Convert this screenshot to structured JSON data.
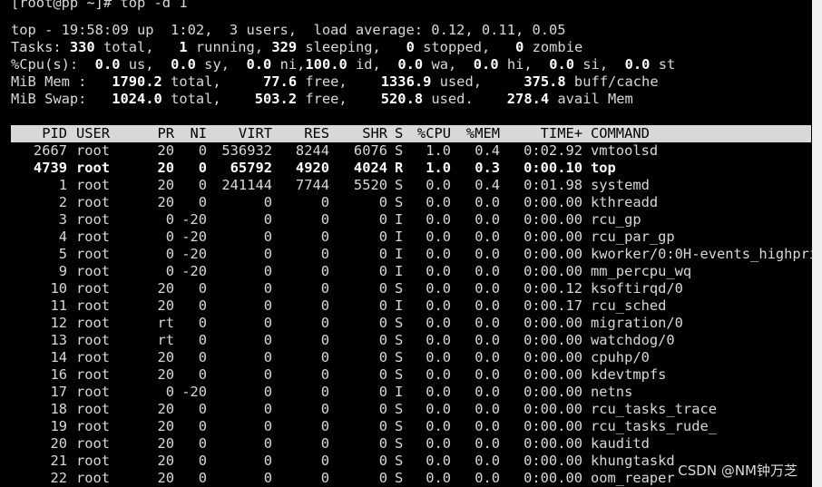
{
  "prompt": "[root@pp ~]# top -d 1",
  "summary": {
    "top_line": [
      "top - 19:58:09 up  1:02,  3 users,  load average: 0.12, 0.11, 0.05"
    ],
    "tasks": [
      {
        "t": "Tasks: ",
        "b": false
      },
      {
        "t": "330",
        "b": true
      },
      {
        "t": " total,   ",
        "b": false
      },
      {
        "t": "1",
        "b": true
      },
      {
        "t": " running, ",
        "b": false
      },
      {
        "t": "329",
        "b": true
      },
      {
        "t": " sleeping,   ",
        "b": false
      },
      {
        "t": "0",
        "b": true
      },
      {
        "t": " stopped,   ",
        "b": false
      },
      {
        "t": "0",
        "b": true
      },
      {
        "t": " zombie",
        "b": false
      }
    ],
    "cpu": [
      {
        "t": "%Cpu(s):  ",
        "b": false
      },
      {
        "t": "0.0",
        "b": true
      },
      {
        "t": " us,  ",
        "b": false
      },
      {
        "t": "0.0",
        "b": true
      },
      {
        "t": " sy,  ",
        "b": false
      },
      {
        "t": "0.0",
        "b": true
      },
      {
        "t": " ni,",
        "b": false
      },
      {
        "t": "100.0",
        "b": true
      },
      {
        "t": " id,  ",
        "b": false
      },
      {
        "t": "0.0",
        "b": true
      },
      {
        "t": " wa,  ",
        "b": false
      },
      {
        "t": "0.0",
        "b": true
      },
      {
        "t": " hi,  ",
        "b": false
      },
      {
        "t": "0.0",
        "b": true
      },
      {
        "t": " si,  ",
        "b": false
      },
      {
        "t": "0.0",
        "b": true
      },
      {
        "t": " st",
        "b": false
      }
    ],
    "mem": [
      {
        "t": "MiB Mem :   ",
        "b": false
      },
      {
        "t": "1790.2",
        "b": true
      },
      {
        "t": " total,     ",
        "b": false
      },
      {
        "t": "77.6",
        "b": true
      },
      {
        "t": " free,    ",
        "b": false
      },
      {
        "t": "1336.9",
        "b": true
      },
      {
        "t": " used,     ",
        "b": false
      },
      {
        "t": "375.8",
        "b": true
      },
      {
        "t": " buff/cache",
        "b": false
      }
    ],
    "swap": [
      {
        "t": "MiB Swap:   ",
        "b": false
      },
      {
        "t": "1024.0",
        "b": true
      },
      {
        "t": " total,    ",
        "b": false
      },
      {
        "t": "503.2",
        "b": true
      },
      {
        "t": " free,    ",
        "b": false
      },
      {
        "t": "520.8",
        "b": true
      },
      {
        "t": " used.    ",
        "b": false
      },
      {
        "t": "278.4",
        "b": true
      },
      {
        "t": " avail Mem",
        "b": false
      }
    ]
  },
  "columns": [
    "PID",
    "USER",
    "PR",
    "NI",
    "VIRT",
    "RES",
    "SHR",
    "S",
    "%CPU",
    "%MEM",
    "TIME+",
    "COMMAND"
  ],
  "processes": [
    {
      "pid": "2667",
      "user": "root",
      "pr": "20",
      "ni": "0",
      "virt": "536932",
      "res": "8244",
      "shr": "6076",
      "s": "S",
      "cpu": "1.0",
      "mem": "0.4",
      "time": "0:02.92",
      "cmd": "vmtoolsd",
      "hl": false
    },
    {
      "pid": "4739",
      "user": "root",
      "pr": "20",
      "ni": "0",
      "virt": "65792",
      "res": "4920",
      "shr": "4024",
      "s": "R",
      "cpu": "1.0",
      "mem": "0.3",
      "time": "0:00.10",
      "cmd": "top",
      "hl": true
    },
    {
      "pid": "1",
      "user": "root",
      "pr": "20",
      "ni": "0",
      "virt": "241144",
      "res": "7744",
      "shr": "5520",
      "s": "S",
      "cpu": "0.0",
      "mem": "0.4",
      "time": "0:01.98",
      "cmd": "systemd",
      "hl": false
    },
    {
      "pid": "2",
      "user": "root",
      "pr": "20",
      "ni": "0",
      "virt": "0",
      "res": "0",
      "shr": "0",
      "s": "S",
      "cpu": "0.0",
      "mem": "0.0",
      "time": "0:00.00",
      "cmd": "kthreadd",
      "hl": false
    },
    {
      "pid": "3",
      "user": "root",
      "pr": "0",
      "ni": "-20",
      "virt": "0",
      "res": "0",
      "shr": "0",
      "s": "I",
      "cpu": "0.0",
      "mem": "0.0",
      "time": "0:00.00",
      "cmd": "rcu_gp",
      "hl": false
    },
    {
      "pid": "4",
      "user": "root",
      "pr": "0",
      "ni": "-20",
      "virt": "0",
      "res": "0",
      "shr": "0",
      "s": "I",
      "cpu": "0.0",
      "mem": "0.0",
      "time": "0:00.00",
      "cmd": "rcu_par_gp",
      "hl": false
    },
    {
      "pid": "5",
      "user": "root",
      "pr": "0",
      "ni": "-20",
      "virt": "0",
      "res": "0",
      "shr": "0",
      "s": "I",
      "cpu": "0.0",
      "mem": "0.0",
      "time": "0:00.00",
      "cmd": "kworker/0:0H-events_highpri",
      "hl": false
    },
    {
      "pid": "9",
      "user": "root",
      "pr": "0",
      "ni": "-20",
      "virt": "0",
      "res": "0",
      "shr": "0",
      "s": "I",
      "cpu": "0.0",
      "mem": "0.0",
      "time": "0:00.00",
      "cmd": "mm_percpu_wq",
      "hl": false
    },
    {
      "pid": "10",
      "user": "root",
      "pr": "20",
      "ni": "0",
      "virt": "0",
      "res": "0",
      "shr": "0",
      "s": "S",
      "cpu": "0.0",
      "mem": "0.0",
      "time": "0:00.12",
      "cmd": "ksoftirqd/0",
      "hl": false
    },
    {
      "pid": "11",
      "user": "root",
      "pr": "20",
      "ni": "0",
      "virt": "0",
      "res": "0",
      "shr": "0",
      "s": "I",
      "cpu": "0.0",
      "mem": "0.0",
      "time": "0:00.17",
      "cmd": "rcu_sched",
      "hl": false
    },
    {
      "pid": "12",
      "user": "root",
      "pr": "rt",
      "ni": "0",
      "virt": "0",
      "res": "0",
      "shr": "0",
      "s": "S",
      "cpu": "0.0",
      "mem": "0.0",
      "time": "0:00.00",
      "cmd": "migration/0",
      "hl": false
    },
    {
      "pid": "13",
      "user": "root",
      "pr": "rt",
      "ni": "0",
      "virt": "0",
      "res": "0",
      "shr": "0",
      "s": "S",
      "cpu": "0.0",
      "mem": "0.0",
      "time": "0:00.00",
      "cmd": "watchdog/0",
      "hl": false
    },
    {
      "pid": "14",
      "user": "root",
      "pr": "20",
      "ni": "0",
      "virt": "0",
      "res": "0",
      "shr": "0",
      "s": "S",
      "cpu": "0.0",
      "mem": "0.0",
      "time": "0:00.00",
      "cmd": "cpuhp/0",
      "hl": false
    },
    {
      "pid": "16",
      "user": "root",
      "pr": "20",
      "ni": "0",
      "virt": "0",
      "res": "0",
      "shr": "0",
      "s": "S",
      "cpu": "0.0",
      "mem": "0.0",
      "time": "0:00.00",
      "cmd": "kdevtmpfs",
      "hl": false
    },
    {
      "pid": "17",
      "user": "root",
      "pr": "0",
      "ni": "-20",
      "virt": "0",
      "res": "0",
      "shr": "0",
      "s": "I",
      "cpu": "0.0",
      "mem": "0.0",
      "time": "0:00.00",
      "cmd": "netns",
      "hl": false
    },
    {
      "pid": "18",
      "user": "root",
      "pr": "20",
      "ni": "0",
      "virt": "0",
      "res": "0",
      "shr": "0",
      "s": "S",
      "cpu": "0.0",
      "mem": "0.0",
      "time": "0:00.00",
      "cmd": "rcu_tasks_trace",
      "hl": false
    },
    {
      "pid": "19",
      "user": "root",
      "pr": "20",
      "ni": "0",
      "virt": "0",
      "res": "0",
      "shr": "0",
      "s": "S",
      "cpu": "0.0",
      "mem": "0.0",
      "time": "0:00.00",
      "cmd": "rcu_tasks_rude_",
      "hl": false
    },
    {
      "pid": "20",
      "user": "root",
      "pr": "20",
      "ni": "0",
      "virt": "0",
      "res": "0",
      "shr": "0",
      "s": "S",
      "cpu": "0.0",
      "mem": "0.0",
      "time": "0:00.00",
      "cmd": "kauditd",
      "hl": false
    },
    {
      "pid": "21",
      "user": "root",
      "pr": "20",
      "ni": "0",
      "virt": "0",
      "res": "0",
      "shr": "0",
      "s": "S",
      "cpu": "0.0",
      "mem": "0.0",
      "time": "0:00.00",
      "cmd": "khungtaskd",
      "hl": false
    },
    {
      "pid": "22",
      "user": "root",
      "pr": "20",
      "ni": "0",
      "virt": "0",
      "res": "0",
      "shr": "0",
      "s": "S",
      "cpu": "0.0",
      "mem": "0.0",
      "time": "0:00.00",
      "cmd": "oom_reaper",
      "hl": false
    }
  ],
  "watermark": "CSDN @NM钟万芝",
  "colors": {
    "background": "#000000",
    "text": "#d8d8d8",
    "bold": "#ffffff",
    "header_bar": "#d8d8d8"
  }
}
